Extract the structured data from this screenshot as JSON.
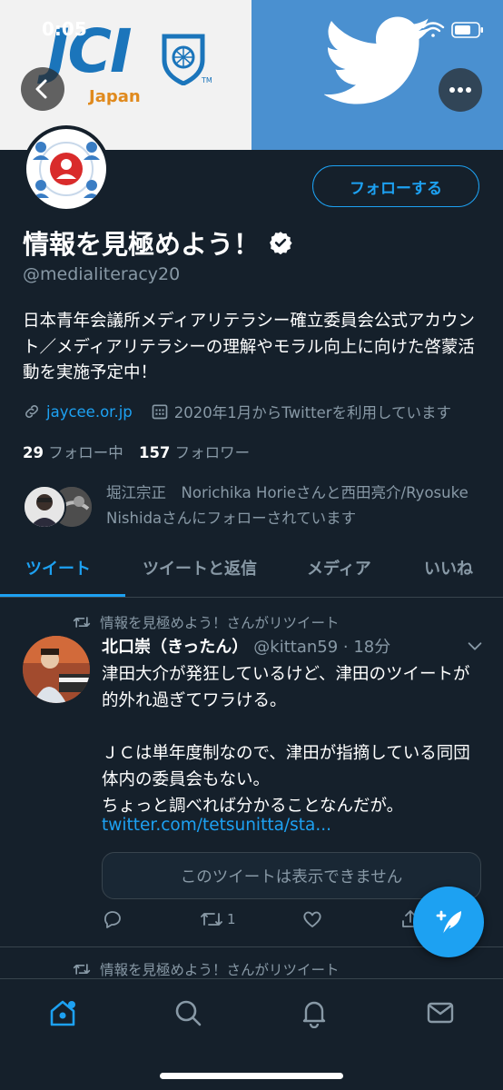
{
  "status_bar": {
    "time": "0:05"
  },
  "banner": {
    "left_text": "JCI",
    "left_subtext": "Japan",
    "tm": "TM"
  },
  "profile": {
    "display_name": "情報を見極めよう！",
    "handle": "@medialiteracy20",
    "follow_button": "フォローする",
    "bio": "日本青年会議所メディアリテラシー確立委員会公式アカウント／メディアリテラシーの理解やモラル向上に向けた啓蒙活動を実施予定中！",
    "website": "jaycee.or.jp",
    "joined": "2020年1月からTwitterを利用しています",
    "following_count": "29",
    "following_label": "フォロー中",
    "followers_count": "157",
    "followers_label": "フォロワー",
    "followed_by": "堀江宗正　Norichika Horieさんと西田亮介/Ryosuke Nishidaさんにフォローされています"
  },
  "tabs": [
    {
      "label": "ツイート",
      "active": true
    },
    {
      "label": "ツイートと返信",
      "active": false
    },
    {
      "label": "メディア",
      "active": false
    },
    {
      "label": "いいね",
      "active": false
    }
  ],
  "tweet": {
    "retweet_context": "情報を見極めよう！さんがリツイート",
    "author_name": "北口崇（きったん）",
    "author_handle_time": "@kittan59 · 18分",
    "text": "津田大介が発狂しているけど、津田のツイートが的外れ過ぎてワラける。\n\nＪＣは単年度制なので、津田が指摘している同団体内の委員会もない。\nちょっと調べれば分かることなんだが。",
    "link": "twitter.com/tetsunitta/sta...",
    "quote_unavailable": "このツイートは表示できません",
    "retweet_count": "1"
  },
  "next_tweet": {
    "retweet_context": "情報を見極めよう！さんがリツイート"
  },
  "colors": {
    "accent": "#1da1f2",
    "background": "#15202b",
    "secondary_text": "#8899a6",
    "banner_blue": "#4a90d0"
  },
  "icons": [
    "back-arrow-icon",
    "more-icon",
    "verified-badge-icon",
    "link-icon",
    "calendar-icon",
    "retweet-icon",
    "reply-icon",
    "like-icon",
    "share-icon",
    "chevron-down-icon",
    "compose-icon",
    "home-icon",
    "search-icon",
    "notifications-icon",
    "messages-icon"
  ]
}
